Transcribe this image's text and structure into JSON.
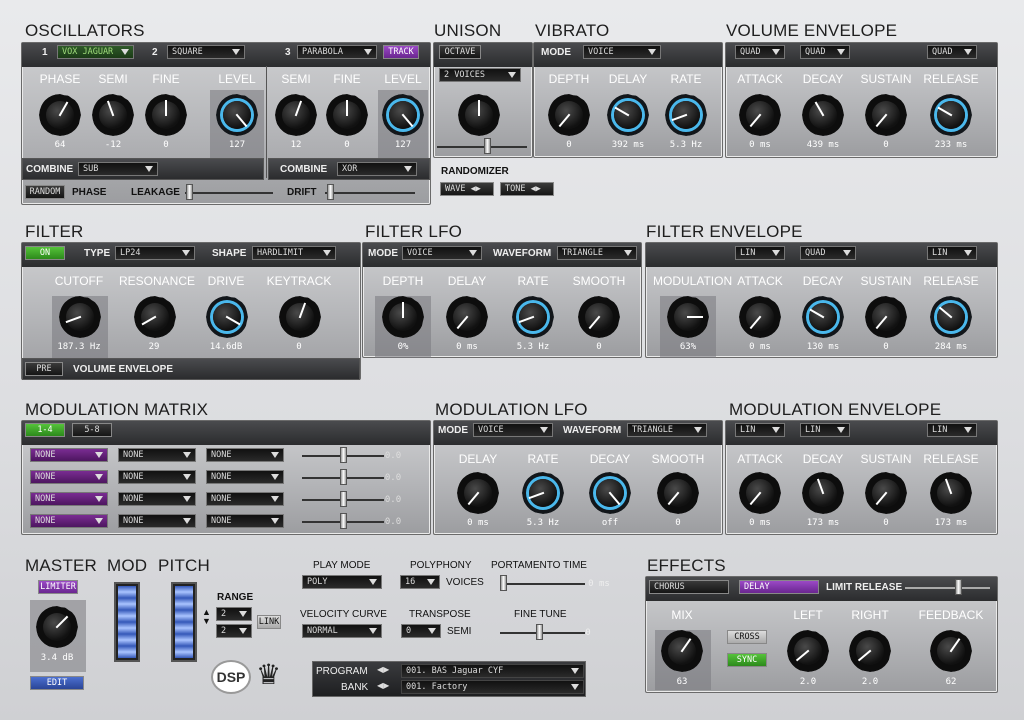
{
  "osc": {
    "title": "OSCILLATORS",
    "n1": "1",
    "w1": "VOX JAGUAR",
    "n2": "2",
    "w2": "SQUARE",
    "n3": "3",
    "w3": "PARABOLA",
    "track": "TRACK",
    "h": [
      "PHASE",
      "SEMI",
      "FINE",
      "LEVEL",
      "SEMI",
      "FINE",
      "LEVEL"
    ],
    "v": [
      "64",
      "-12",
      "0",
      "127",
      "12",
      "0",
      "127"
    ],
    "combine": "COMBINE",
    "comb1": "SUB",
    "comb2": "XOR",
    "random": "RANDOM",
    "phase": "PHASE",
    "leakage": "LEAKAGE",
    "drift": "DRIFT"
  },
  "unison": {
    "title": "UNISON",
    "octave": "OCTAVE",
    "voices": "2 VOICES",
    "randomizer": "RANDOMIZER",
    "wave": "WAVE",
    "tone": "TONE"
  },
  "vibrato": {
    "title": "VIBRATO",
    "mode": "MODE",
    "mode_val": "VOICE",
    "h": [
      "DEPTH",
      "DELAY",
      "RATE"
    ],
    "v": [
      "0",
      "392 ms",
      "5.3 Hz"
    ]
  },
  "venv": {
    "title": "VOLUME ENVELOPE",
    "c1": "QUAD",
    "c2": "QUAD",
    "c3": "QUAD",
    "h": [
      "ATTACK",
      "DECAY",
      "SUSTAIN",
      "RELEASE"
    ],
    "v": [
      "0 ms",
      "439 ms",
      "0",
      "233 ms"
    ]
  },
  "filter": {
    "title": "FILTER",
    "on": "ON",
    "type": "TYPE",
    "type_val": "LP24",
    "shape": "SHAPE",
    "shape_val": "HARDLIMIT",
    "h": [
      "CUTOFF",
      "RESONANCE",
      "DRIVE",
      "KEYTRACK"
    ],
    "v": [
      "187.3 Hz",
      "29",
      "14.6dB",
      "0"
    ],
    "pre": "PRE",
    "venv": "VOLUME ENVELOPE"
  },
  "flfo": {
    "title": "FILTER LFO",
    "mode": "MODE",
    "mode_val": "VOICE",
    "waveform": "WAVEFORM",
    "wave_val": "TRIANGLE",
    "h": [
      "DEPTH",
      "DELAY",
      "RATE",
      "SMOOTH"
    ],
    "v": [
      "0%",
      "0 ms",
      "5.3 Hz",
      "0"
    ]
  },
  "fenv": {
    "title": "FILTER ENVELOPE",
    "c1": "LIN",
    "c2": "QUAD",
    "c3": "LIN",
    "h": [
      "MODULATION",
      "ATTACK",
      "DECAY",
      "SUSTAIN",
      "RELEASE"
    ],
    "v": [
      "63%",
      "0 ms",
      "130 ms",
      "0",
      "284 ms"
    ]
  },
  "matrix": {
    "title": "MODULATION MATRIX",
    "tab1": "1-4",
    "tab2": "5-8",
    "rows": [
      {
        "a": "NONE",
        "b": "NONE",
        "c": "NONE",
        "v": "0.0"
      },
      {
        "a": "NONE",
        "b": "NONE",
        "c": "NONE",
        "v": "0.0"
      },
      {
        "a": "NONE",
        "b": "NONE",
        "c": "NONE",
        "v": "0.0"
      },
      {
        "a": "NONE",
        "b": "NONE",
        "c": "NONE",
        "v": "0.0"
      }
    ]
  },
  "mlfo": {
    "title": "MODULATION LFO",
    "mode": "MODE",
    "mode_val": "VOICE",
    "waveform": "WAVEFORM",
    "wave_val": "TRIANGLE",
    "h": [
      "DELAY",
      "RATE",
      "DECAY",
      "SMOOTH"
    ],
    "v": [
      "0 ms",
      "5.3 Hz",
      "off",
      "0"
    ]
  },
  "menv": {
    "title": "MODULATION ENVELOPE",
    "c1": "LIN",
    "c2": "LIN",
    "c3": "LIN",
    "h": [
      "ATTACK",
      "DECAY",
      "SUSTAIN",
      "RELEASE"
    ],
    "v": [
      "0 ms",
      "173 ms",
      "0",
      "173 ms"
    ]
  },
  "master": {
    "title": "MASTER",
    "limiter": "LIMITER",
    "value": "3.4 dB",
    "edit": "EDIT"
  },
  "mod": {
    "title": "MOD"
  },
  "pitch": {
    "title": "PITCH",
    "range": "RANGE",
    "r1": "2",
    "r2": "2",
    "link": "LINK"
  },
  "play": {
    "playmode": "PLAY MODE",
    "playmode_val": "POLY",
    "polyphony": "POLYPHONY",
    "poly_val": "16",
    "voices": "VOICES",
    "porta": "PORTAMENTO TIME",
    "porta_val": "0 ms",
    "velocity": "VELOCITY CURVE",
    "vel_val": "NORMAL",
    "transpose": "TRANSPOSE",
    "trans_val": "0",
    "semi": "SEMI",
    "finetune": "FINE TUNE",
    "ft_val": "0"
  },
  "logo": {
    "dsp": "DSP"
  },
  "program": {
    "label": "PROGRAM",
    "value": "001. BAS Jaguar CYF",
    "bank_label": "BANK",
    "bank_value": "001. Factory"
  },
  "effects": {
    "title": "EFFECTS",
    "chorus": "CHORUS",
    "delay": "DELAY",
    "limit": "LIMIT RELEASE",
    "h": [
      "MIX",
      "LEFT",
      "RIGHT",
      "FEEDBACK"
    ],
    "v": [
      "63",
      "2.0",
      "2.0",
      "62"
    ],
    "cross": "CROSS",
    "sync": "SYNC"
  }
}
